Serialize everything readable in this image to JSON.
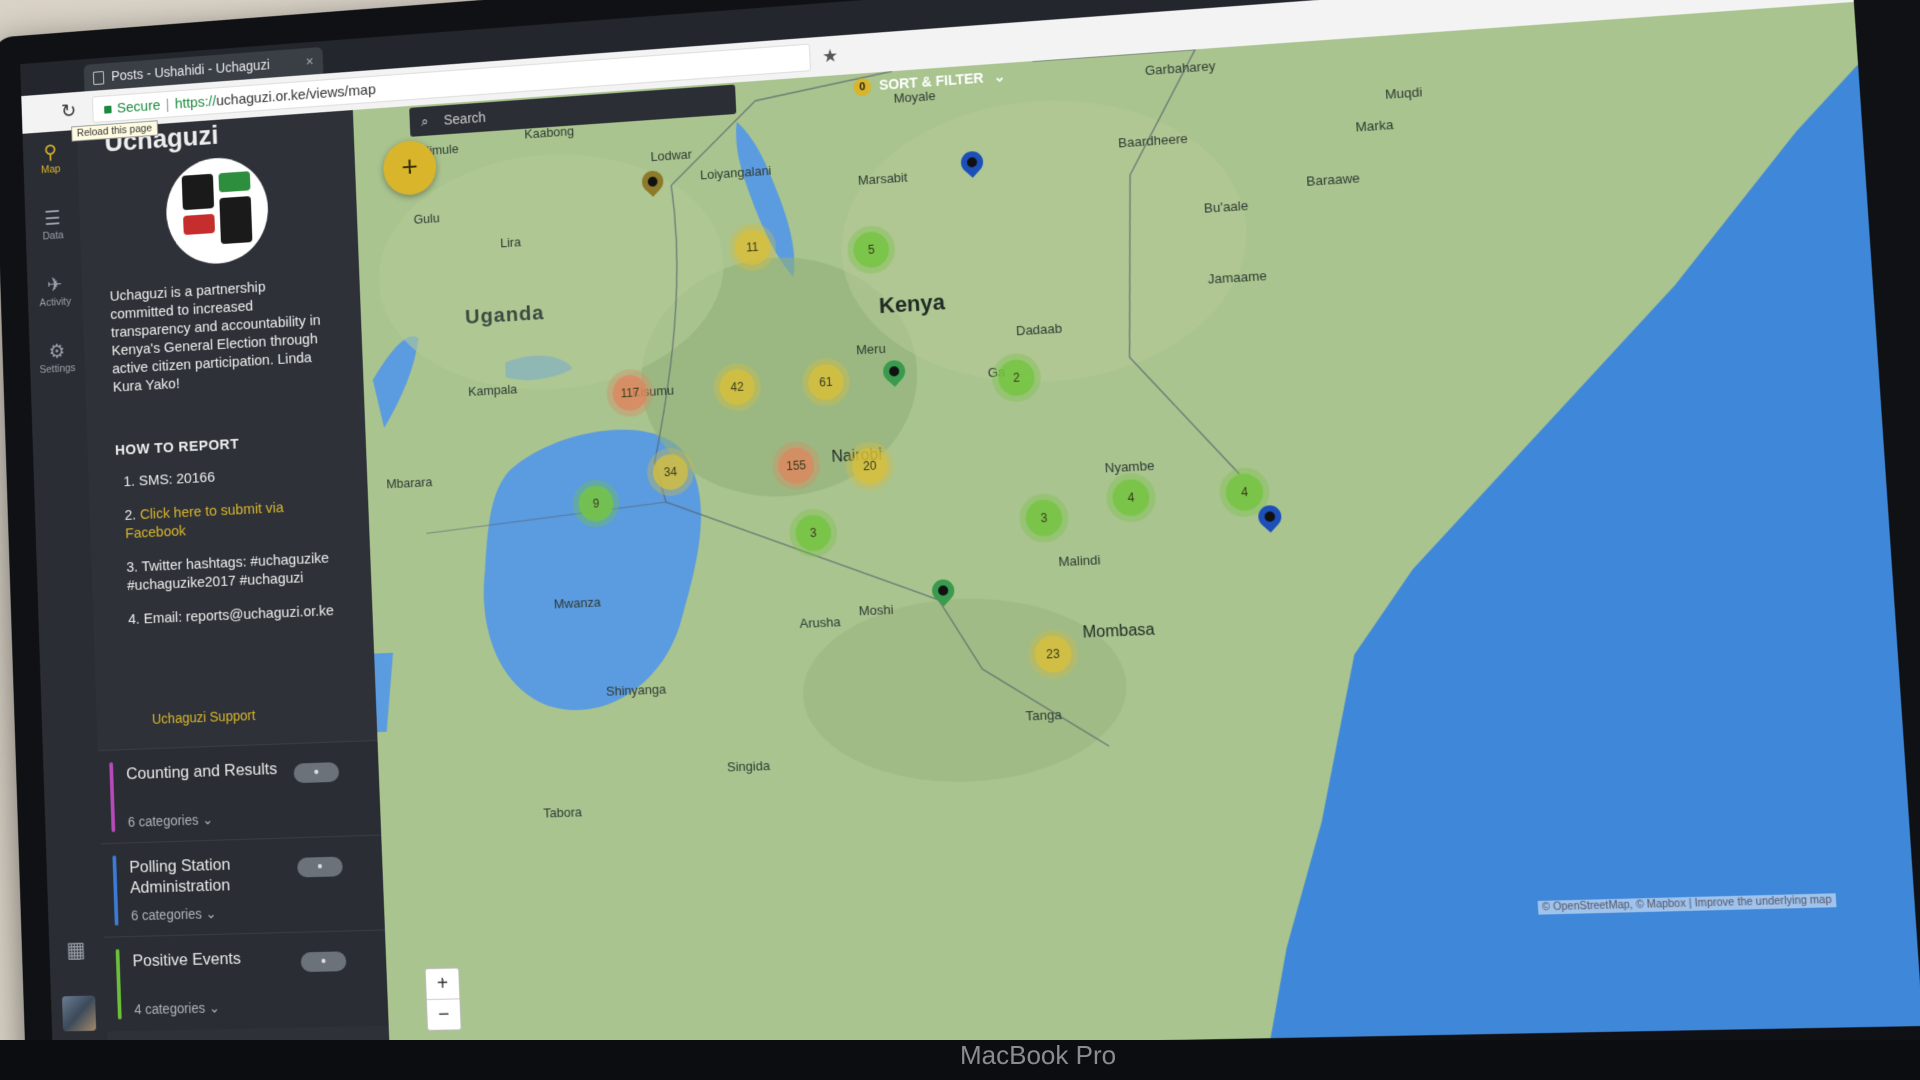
{
  "browser": {
    "tab_title": "Posts - Ushahidi - Uchaguzi",
    "tab_close": "×",
    "secure_label": "Secure",
    "url_protocol": "https://",
    "url_rest": "uchaguzi.or.ke/views/map",
    "reload_tooltip": "Reload this page",
    "star_icon": "★"
  },
  "app": {
    "brand": "Uchaguzi",
    "sort_filter": {
      "count": "0",
      "label": "SORT & FILTER",
      "chevron": "⌄"
    },
    "search_placeholder": "Search",
    "add_button": "+"
  },
  "rail": [
    {
      "label": "Map",
      "icon": "map-marker-icon",
      "glyph": "⚲",
      "active": true
    },
    {
      "label": "Data",
      "icon": "data-icon",
      "glyph": "☰",
      "active": false
    },
    {
      "label": "Activity",
      "icon": "activity-icon",
      "glyph": "✈",
      "active": false
    },
    {
      "label": "Settings",
      "icon": "gear-icon",
      "glyph": "⚙",
      "active": false
    }
  ],
  "sidebar": {
    "about": "Uchaguzi is a partnership committed to increased transparency and accountability in Kenya's General Election through active citizen participation. Linda Kura Yako!",
    "howto_title": "HOW TO REPORT",
    "steps": {
      "s1": "1. SMS: 20166",
      "s2_prefix": "2. ",
      "s2_link": "Click here to submit via Facebook",
      "s3": "3. Twitter hashtags: #uchaguzike #uchaguzike2017 #uchaguzi",
      "s4": "4. Email: reports@uchaguzi.or.ke"
    },
    "support": "Uchaguzi Support",
    "surveys": [
      {
        "title": "Counting and Results",
        "cats": "6 categories ⌄",
        "color": "#b54ab8"
      },
      {
        "title": "Polling Station Administration",
        "cats": "6 categories ⌄",
        "color": "#3b7bd4"
      },
      {
        "title": "Positive Events",
        "cats": "4 categories ⌄",
        "color": "#6cbf3a"
      }
    ]
  },
  "map": {
    "labels": {
      "kenya": "Kenya",
      "uganda": "Uganda",
      "nairobi": "Nairobi",
      "mombasa": "Mombasa",
      "moyale": "Moyale",
      "marsabit": "Marsabit",
      "lodwar": "Lodwar",
      "loiyangalani": "Loiyangalani",
      "kaabong": "Kaabong",
      "nimule": "Nimule",
      "gulu": "Gulu",
      "lira": "Lira",
      "kampala": "Kampala",
      "kisumu": "Kisumu",
      "meru": "Meru",
      "dadaab": "Dadaab",
      "garissa": "Ga",
      "mbarara": "Mbarara",
      "mwanza": "Mwanza",
      "arusha": "Arusha",
      "moshi": "Moshi",
      "shinyanga": "Shinyanga",
      "singida": "Singida",
      "tabora": "Tabora",
      "tanga": "Tanga",
      "malindi": "Malindi",
      "nyambeni": "Nyambe",
      "jamaame": "Jamaame",
      "buaale": "Bu'aale",
      "baraawe": "Baraawe",
      "baardheere": "Baardheere",
      "garbaharey": "Garbaharey",
      "marka": "Marka",
      "muqdisho": "Muqdi"
    },
    "clusters": [
      {
        "value": "11",
        "kind": "y"
      },
      {
        "value": "5",
        "kind": "g"
      },
      {
        "value": "117",
        "kind": "o"
      },
      {
        "value": "42",
        "kind": "y"
      },
      {
        "value": "61",
        "kind": "y"
      },
      {
        "value": "2",
        "kind": "g"
      },
      {
        "value": "34",
        "kind": "y"
      },
      {
        "value": "155",
        "kind": "o"
      },
      {
        "value": "20",
        "kind": "y"
      },
      {
        "value": "9",
        "kind": "g"
      },
      {
        "value": "3",
        "kind": "g"
      },
      {
        "value": "3",
        "kind": "g"
      },
      {
        "value": "4",
        "kind": "g"
      },
      {
        "value": "4",
        "kind": "g"
      },
      {
        "value": "23",
        "kind": "y"
      }
    ],
    "zoom_in": "+",
    "zoom_out": "−",
    "attribution": "© OpenStreetMap, © Mapbox | Improve the underlying map"
  },
  "device": {
    "label": "MacBook Pro"
  }
}
